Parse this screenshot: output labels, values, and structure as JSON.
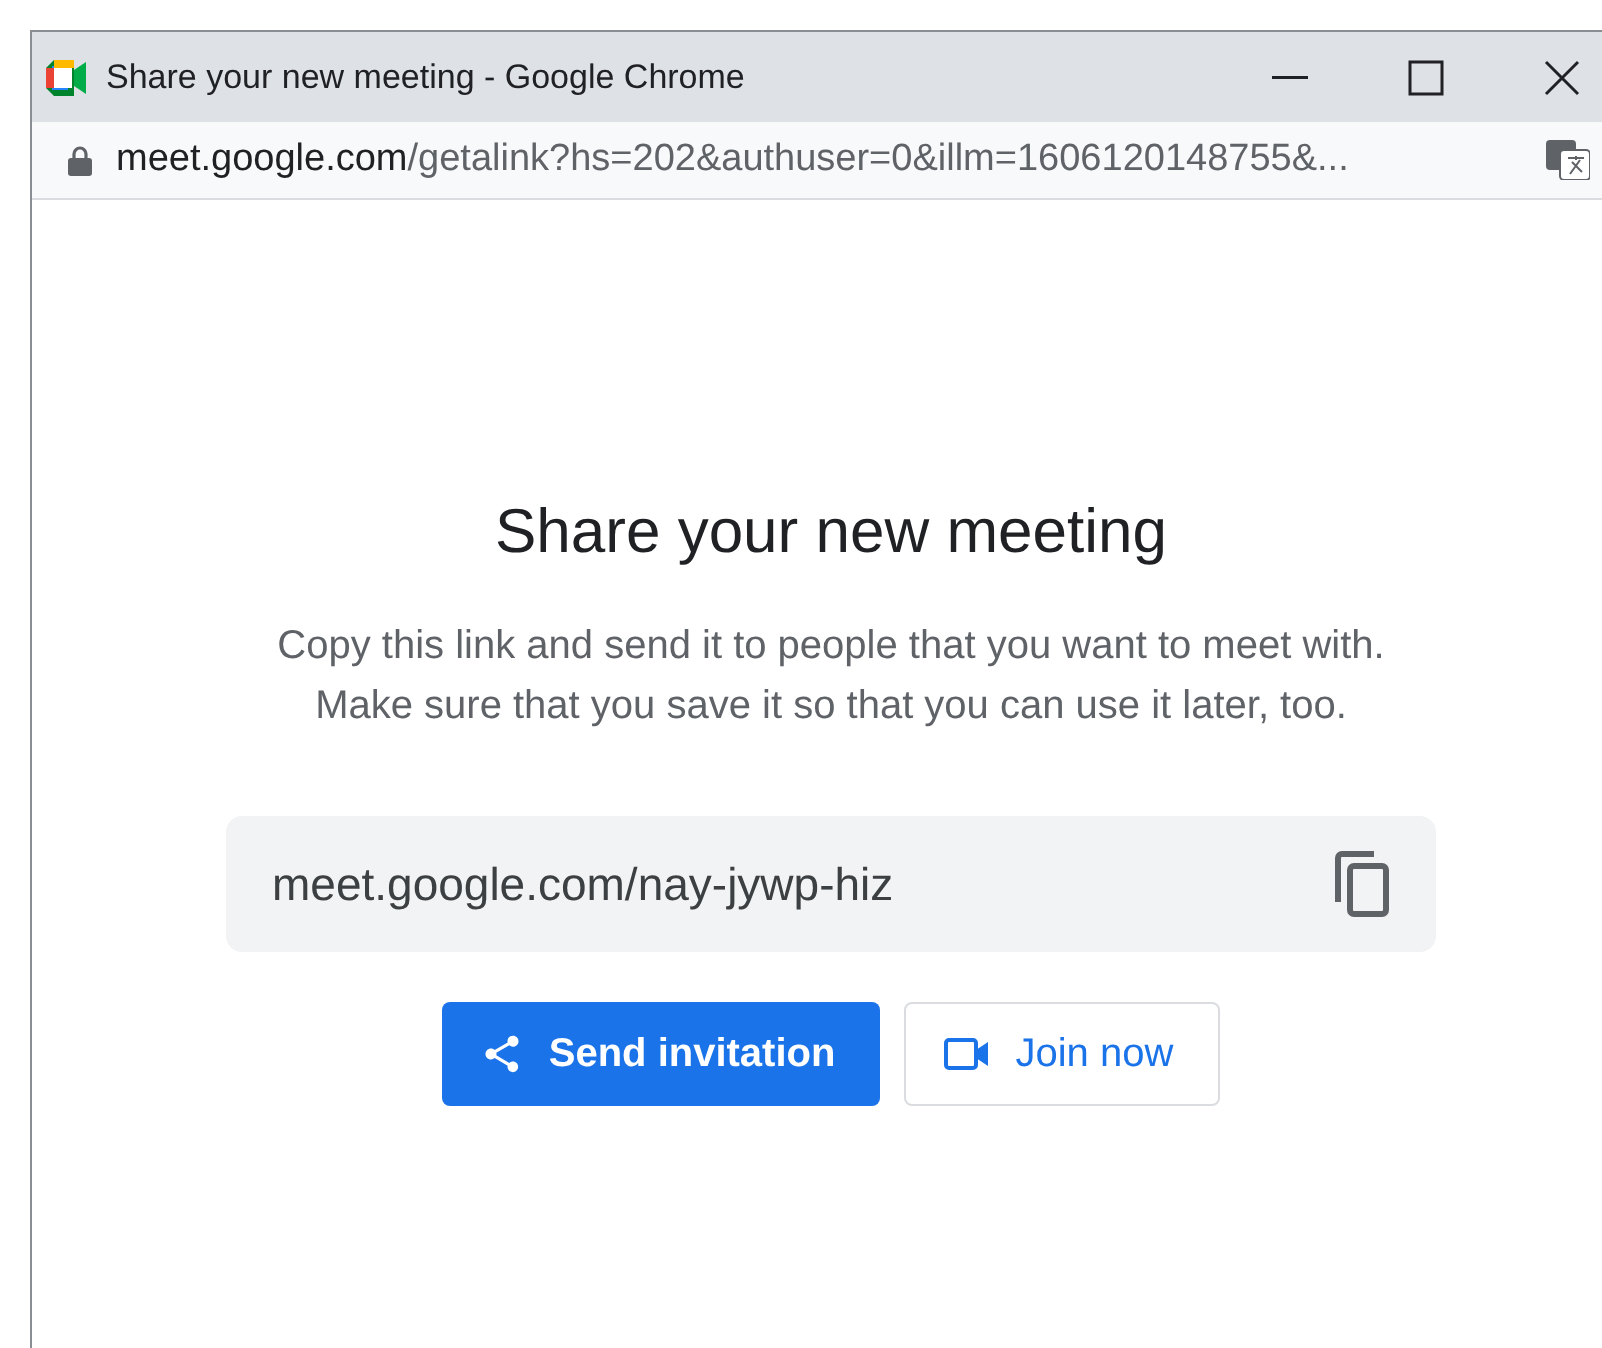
{
  "window": {
    "title": "Share your new meeting - Google Chrome"
  },
  "address_bar": {
    "host": "meet.google.com",
    "path": "/getalink?hs=202&authuser=0&illm=1606120148755&..."
  },
  "dialog": {
    "heading": "Share your new meeting",
    "description_lines": [
      "Copy this link and send it to people that you want to meet with.",
      "Make sure that you save it so that you can use it later, too."
    ],
    "link": "meet.google.com/nay-jywp-hiz"
  },
  "buttons": [
    {
      "kind": "primary",
      "label": "Send invitation"
    },
    {
      "kind": "outline",
      "label": "Join now"
    }
  ]
}
